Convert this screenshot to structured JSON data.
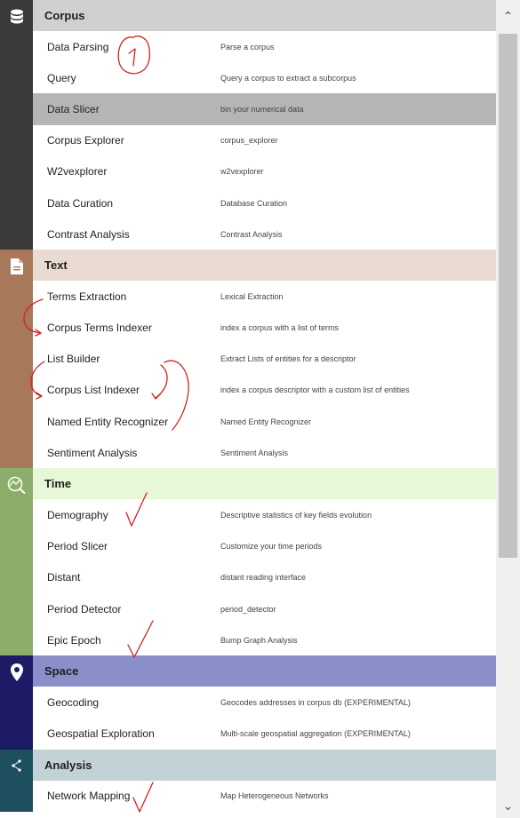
{
  "sections": [
    {
      "title": "Corpus",
      "icon": "database-icon",
      "side_color": "#3a3a3a",
      "header_bg": "#d0d0d0",
      "items": [
        {
          "name": "Data Parsing",
          "desc": "Parse a corpus"
        },
        {
          "name": "Query",
          "desc": "Query a corpus to extract a subcorpus"
        },
        {
          "name": "Data Slicer",
          "desc": "bin your numerical data",
          "selected": true
        },
        {
          "name": "Corpus Explorer",
          "desc": "corpus_explorer"
        },
        {
          "name": "W2vexplorer",
          "desc": "w2vexplorer"
        },
        {
          "name": "Data Curation",
          "desc": "Database Curation"
        },
        {
          "name": "Contrast Analysis",
          "desc": "Contrast Analysis"
        }
      ]
    },
    {
      "title": "Text",
      "icon": "document-icon",
      "side_color": "#a8785a",
      "header_bg": "#e9dbd2",
      "items": [
        {
          "name": "Terms Extraction",
          "desc": "Lexical Extraction"
        },
        {
          "name": "Corpus Terms Indexer",
          "desc": "index a corpus with a list of terms"
        },
        {
          "name": "List Builder",
          "desc": "Extract Lists of entities for a descriptor"
        },
        {
          "name": "Corpus List Indexer",
          "desc": "index a corpus descriptor with a custom list of entities"
        },
        {
          "name": "Named Entity Recognizer",
          "desc": "Named Entity Recognizer"
        },
        {
          "name": "Sentiment Analysis",
          "desc": "Sentiment Analysis"
        }
      ]
    },
    {
      "title": "Time",
      "icon": "trend-search-icon",
      "side_color": "#8cae6a",
      "header_bg": "#e6f8d8",
      "items": [
        {
          "name": "Demography",
          "desc": "Descriptive statistics of key fields evolution"
        },
        {
          "name": "Period Slicer",
          "desc": "Customize your time periods"
        },
        {
          "name": "Distant",
          "desc": "distant reading interface"
        },
        {
          "name": "Period Detector",
          "desc": "period_detector"
        },
        {
          "name": "Epic Epoch",
          "desc": "Bump Graph Analysis"
        }
      ]
    },
    {
      "title": "Space",
      "icon": "map-pin-icon",
      "side_color": "#1d1a66",
      "header_bg": "#8a8ec9",
      "items": [
        {
          "name": "Geocoding",
          "desc": "Geocodes addresses in corpus db (EXPERIMENTAL)"
        },
        {
          "name": "Geospatial Exploration",
          "desc": "Multi-scale geospatial aggregation (EXPERIMENTAL)"
        }
      ]
    },
    {
      "title": "Analysis",
      "icon": "network-icon",
      "side_color": "#1e4f5f",
      "header_bg": "#c3d2d6",
      "items": [
        {
          "name": "Network Mapping",
          "desc": "Map Heterogeneous Networks"
        }
      ]
    }
  ],
  "annotations": {
    "circled_number": "1",
    "stroke_color": "#d42020"
  },
  "scrollbar": {
    "up_icon": "chevron-up-icon",
    "down_icon": "chevron-down-icon"
  }
}
